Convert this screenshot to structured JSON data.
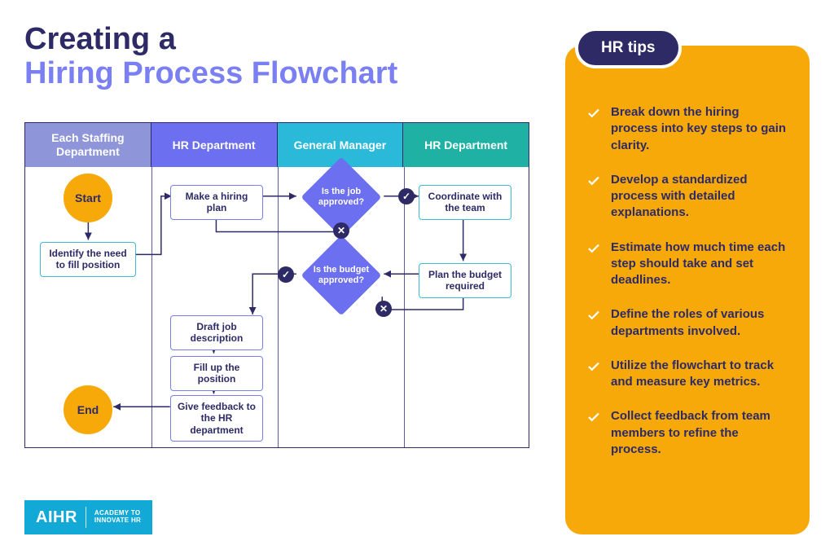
{
  "title_line1": "Creating a",
  "title_line2": "Hiring Process Flowchart",
  "tips_label": "HR tips",
  "tips": [
    "Break down the hiring process into key steps to gain clarity.",
    "Develop a standardized process with detailed explanations.",
    "Estimate how much time each step should take and set deadlines.",
    "Define the roles of various departments involved.",
    "Utilize the flowchart to track and measure key metrics.",
    "Collect feedback from team members to refine the process."
  ],
  "lanes": [
    {
      "label": "Each Staffing Department",
      "color": "#8e95d9"
    },
    {
      "label": "HR Department",
      "color": "#6b6ff0"
    },
    {
      "label": "General Manager",
      "color": "#2bb9da"
    },
    {
      "label": "HR Department",
      "color": "#1fb1a4"
    }
  ],
  "nodes": {
    "start": {
      "label": "Start"
    },
    "identify": {
      "label": "Identify the need to fill position"
    },
    "hiring_plan": {
      "label": "Make a hiring plan"
    },
    "job_approved": {
      "label": "Is the job approved?"
    },
    "coordinate": {
      "label": "Coordinate with the team"
    },
    "plan_budget": {
      "label": "Plan the budget required"
    },
    "budget_appr": {
      "label": "Is the budget approved?"
    },
    "draft": {
      "label": "Draft job description"
    },
    "fill": {
      "label": "Fill up the position"
    },
    "feedback": {
      "label": "Give feedback to the HR department"
    },
    "end": {
      "label": "End"
    }
  },
  "decision_marks": {
    "yes": "✓",
    "no": "✕"
  },
  "logo": {
    "big": "AIHR",
    "small1": "ACADEMY TO",
    "small2": "INNOVATE HR"
  }
}
